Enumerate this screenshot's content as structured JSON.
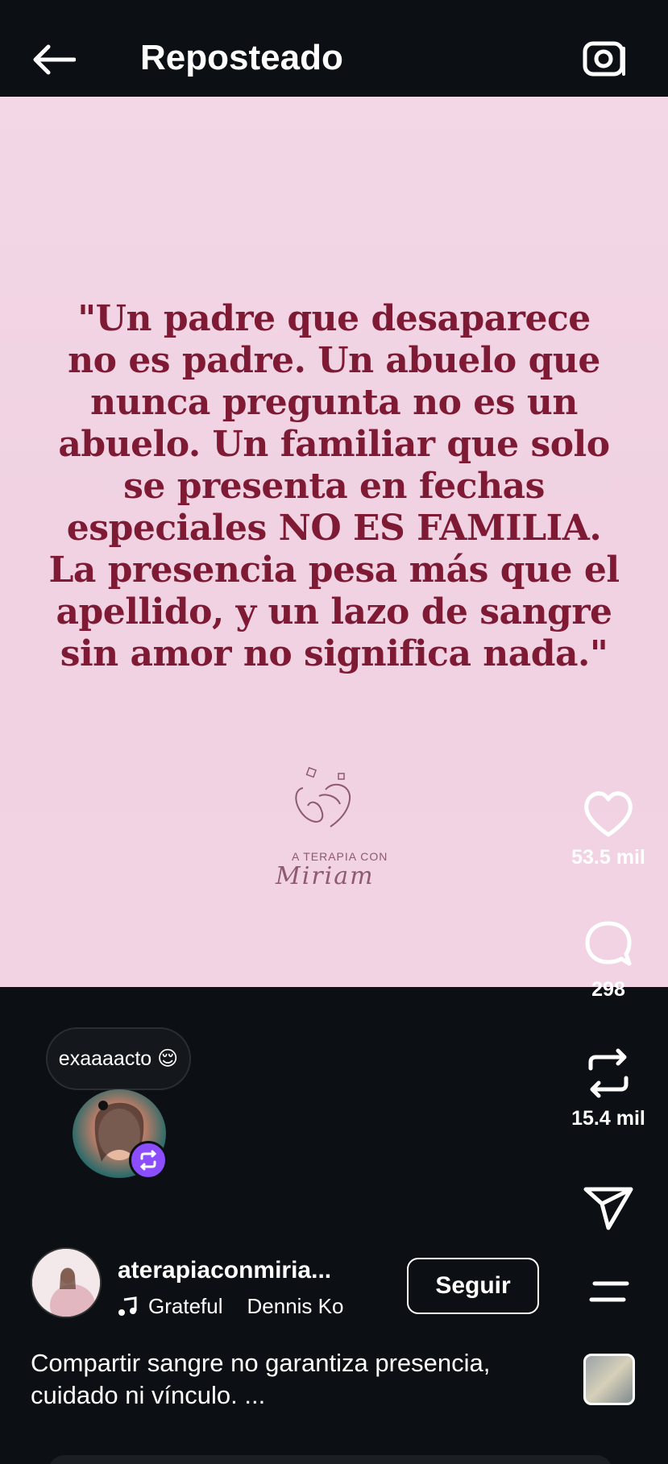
{
  "header": {
    "title": "Reposteado"
  },
  "post": {
    "quote": "\"Un padre que desaparece no es padre. Un abuelo que nunca pregunta no es un abuelo. Un familiar que solo se presenta en fechas especiales NO ES FAMILIA. La presencia pesa más que el apellido, y un lazo de sangre sin amor no significa nada.\"",
    "logo_top": "A TERAPIA CON",
    "logo_script": "Miriam"
  },
  "actions": {
    "likes": "53.5 mil",
    "comments": "298",
    "reposts": "15.4 mil"
  },
  "repost_note": {
    "text": "exaaaacto 😌"
  },
  "author": {
    "username": "aterapiaconmiria...",
    "music_title": "Grateful",
    "music_artist": "Dennis Ko",
    "follow_label": "Seguir"
  },
  "caption": "Compartir sangre no garantiza presencia, cuidado ni vínculo. ...",
  "colors": {
    "background": "#0c1014",
    "post_bg": "#f1d3e3",
    "quote_text": "#7f1a35",
    "repost_badge": "#8c4dff"
  },
  "icons": [
    "back-arrow-icon",
    "camera-icon",
    "heart-icon",
    "comment-icon",
    "repost-icon",
    "send-icon",
    "music-note-icon",
    "menu-icon"
  ]
}
